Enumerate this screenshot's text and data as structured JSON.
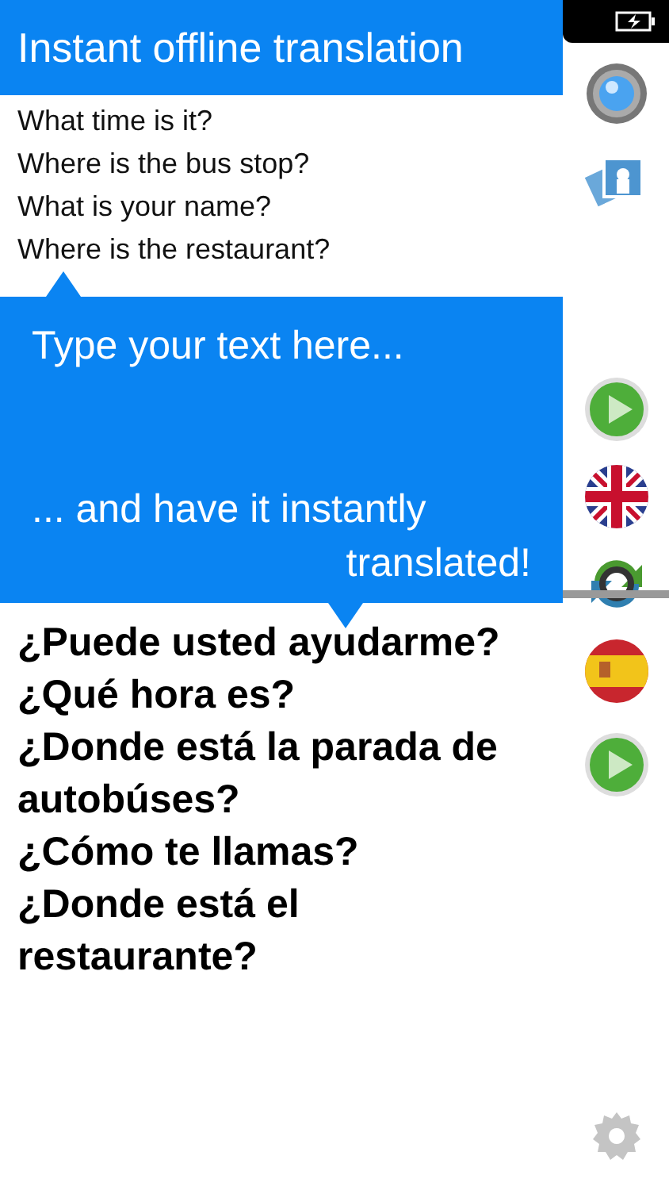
{
  "banner": {
    "title": "Instant offline translation"
  },
  "source_lines": [
    "What time is it?",
    "Where is the bus stop?",
    "What is your name?",
    "Where is the restaurant?"
  ],
  "callout": {
    "lines": [
      "Type your text here...",
      "... and have it instantly",
      "translated!"
    ]
  },
  "translation_lines": [
    "¿Puede usted ayudarme?",
    "¿Qué hora es?",
    "¿Donde está la parada de autobúses?",
    "¿Cómo te llamas?",
    "¿Donde está el restaurante?"
  ],
  "sidebar": {
    "buttons": [
      {
        "kind": "camera"
      },
      {
        "kind": "photos"
      },
      {
        "kind": "play"
      },
      {
        "kind": "flag_uk"
      },
      {
        "kind": "swap"
      },
      {
        "kind": "flag_es"
      },
      {
        "kind": "play"
      },
      {
        "kind": "settings"
      }
    ]
  }
}
